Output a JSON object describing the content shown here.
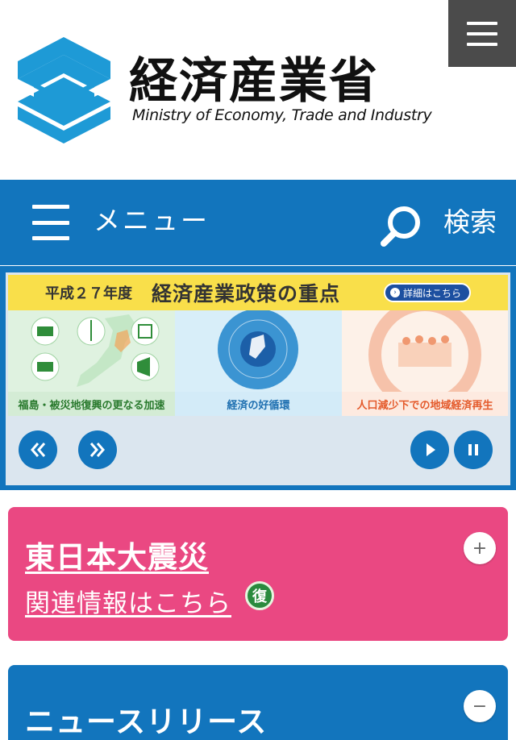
{
  "header": {
    "logo_ja": "経済産業省",
    "logo_en": "Ministry of Economy, Trade and Industry"
  },
  "nav": {
    "menu_label": "メニュー",
    "search_label": "検索"
  },
  "banner": {
    "year": "平成２７年度",
    "title": "経済産業政策の重点",
    "detail": "詳細はこちら",
    "panels": [
      {
        "caption": "福島・被災地復興の更なる加速"
      },
      {
        "caption": "経済の好循環"
      },
      {
        "caption": "人口減少下での地域経済再生"
      }
    ]
  },
  "disaster": {
    "title": "東日本大震災",
    "link": "関連情報はこちら",
    "badge": "復",
    "toggle": "+"
  },
  "news": {
    "title": "ニュースリリース",
    "toggle": "−"
  },
  "colors": {
    "brand_blue": "#1275bd",
    "pink": "#ea4882",
    "dark_gray": "#4b4b4b",
    "logo_cyan": "#1e9ad6"
  }
}
